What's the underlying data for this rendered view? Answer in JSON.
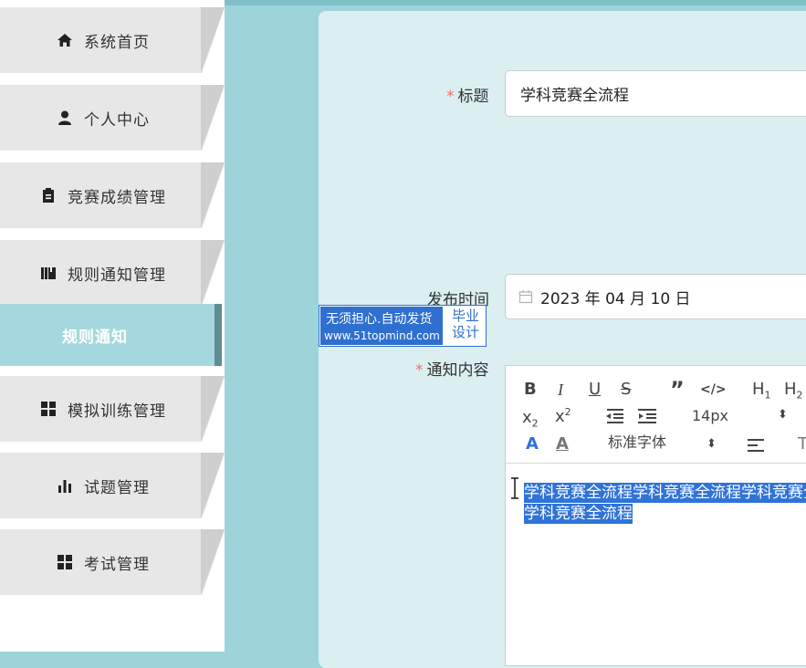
{
  "sidebar": {
    "items": [
      {
        "label": "系统首页",
        "icon": "home-icon"
      },
      {
        "label": "个人中心",
        "icon": "user-icon"
      },
      {
        "label": "竞赛成绩管理",
        "icon": "clipboard-icon"
      },
      {
        "label": "规则通知管理",
        "icon": "book-icon"
      },
      {
        "label": "模拟训练管理",
        "icon": "grid-icon"
      },
      {
        "label": "试题管理",
        "icon": "bar-chart-icon"
      },
      {
        "label": "考试管理",
        "icon": "grid-icon"
      }
    ],
    "active_sub": "规则通知"
  },
  "form": {
    "title_label": "标题",
    "title_value": "学科竞赛全流程",
    "date_label": "发布时间",
    "date_value": "2023 年 04 月 10 日",
    "content_label": "通知内容",
    "editor": {
      "font_size": "14px",
      "font_family": "标准字体",
      "content_line1": "学科竞赛全流程学科竞赛全流程学科竞赛全",
      "content_line2": "学科竞赛全流程"
    }
  },
  "watermark": {
    "line1": "无须担心.自动发货",
    "line2": "www.51topmind.com",
    "right_line1": "毕业",
    "right_line2": "设计"
  },
  "colors": {
    "accent": "#9dd4da",
    "selection": "#2f73d8",
    "required": "#f56c6c"
  }
}
